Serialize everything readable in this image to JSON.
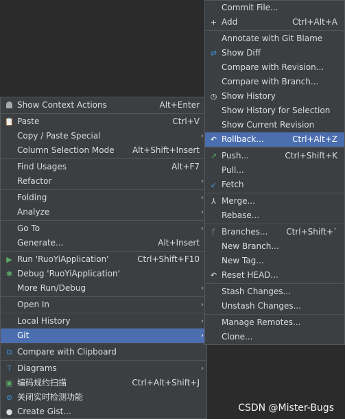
{
  "left_menu": {
    "items": [
      {
        "label": "Show Context Actions",
        "shortcut": "Alt+Enter",
        "icon": "lightbulb-icon"
      },
      {
        "label": "Paste",
        "shortcut": "Ctrl+V",
        "icon": "clipboard-icon"
      },
      {
        "label": "Copy / Paste Special",
        "arrow": "›"
      },
      {
        "label": "Column Selection Mode",
        "shortcut": "Alt+Shift+Insert"
      },
      {
        "label": "Find Usages",
        "shortcut": "Alt+F7"
      },
      {
        "label": "Refactor",
        "arrow": "›"
      },
      {
        "label": "Folding",
        "arrow": "›"
      },
      {
        "label": "Analyze",
        "arrow": "›"
      },
      {
        "label": "Go To",
        "arrow": "›"
      },
      {
        "label": "Generate...",
        "shortcut": "Alt+Insert"
      },
      {
        "label": "Run 'RuoYiApplication'",
        "shortcut": "Ctrl+Shift+F10",
        "icon": "run-icon"
      },
      {
        "label": "Debug 'RuoYiApplication'",
        "icon": "debug-icon"
      },
      {
        "label": "More Run/Debug",
        "arrow": "›"
      },
      {
        "label": "Open In",
        "arrow": "›"
      },
      {
        "label": "Local History",
        "arrow": "›"
      },
      {
        "label": "Git",
        "arrow": "›",
        "selected": true
      },
      {
        "label": "Compare with Clipboard",
        "icon": "compare-clipboard-icon"
      },
      {
        "label": "Diagrams",
        "arrow": "›",
        "icon": "diagram-icon"
      },
      {
        "label": "编码规约扫描",
        "shortcut": "Ctrl+Alt+Shift+J",
        "icon": "scan-icon"
      },
      {
        "label": "关闭实时检测功能",
        "icon": "disable-icon"
      },
      {
        "label": "Create Gist...",
        "icon": "github-icon"
      }
    ]
  },
  "right_menu": {
    "items": [
      {
        "label": "Commit File..."
      },
      {
        "label": "Add",
        "shortcut": "Ctrl+Alt+A",
        "icon": "plus-icon"
      },
      {
        "label": "Annotate with Git Blame"
      },
      {
        "label": "Show Diff",
        "icon": "diff-icon"
      },
      {
        "label": "Compare with Revision..."
      },
      {
        "label": "Compare with Branch..."
      },
      {
        "label": "Show History",
        "icon": "clock-icon"
      },
      {
        "label": "Show History for Selection"
      },
      {
        "label": "Show Current Revision"
      },
      {
        "label": "Rollback...",
        "shortcut": "Ctrl+Alt+Z",
        "icon": "rollback-icon",
        "selected": true
      },
      {
        "label": "Push...",
        "shortcut": "Ctrl+Shift+K",
        "icon": "push-icon"
      },
      {
        "label": "Pull..."
      },
      {
        "label": "Fetch",
        "icon": "fetch-icon"
      },
      {
        "label": "Merge...",
        "icon": "merge-icon"
      },
      {
        "label": "Rebase..."
      },
      {
        "label": "Branches...",
        "shortcut": "Ctrl+Shift+`",
        "icon": "branch-icon"
      },
      {
        "label": "New Branch..."
      },
      {
        "label": "New Tag..."
      },
      {
        "label": "Reset HEAD...",
        "icon": "reset-icon"
      },
      {
        "label": "Stash Changes..."
      },
      {
        "label": "Unstash Changes..."
      },
      {
        "label": "Manage Remotes..."
      },
      {
        "label": "Clone..."
      }
    ]
  },
  "watermark": "CSDN @Mister-Bugs",
  "colors": {
    "menu_bg": "#3c3f41",
    "selection": "#4b6eaf",
    "editor_bg": "#2b2b2b",
    "text": "#dcdcdc"
  }
}
